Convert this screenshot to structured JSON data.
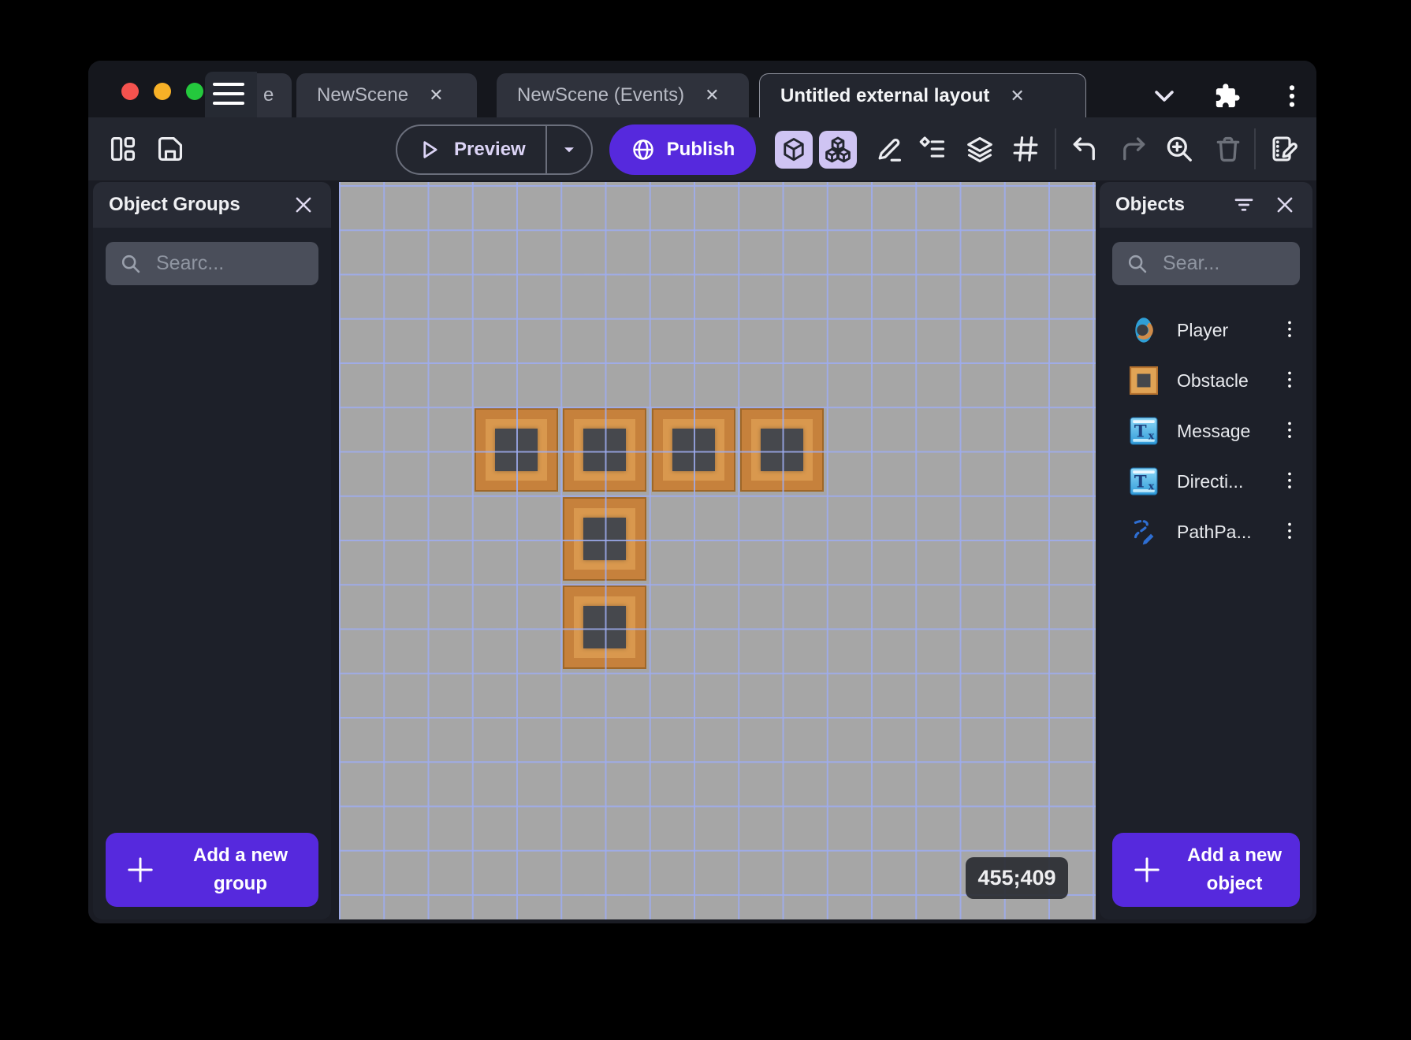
{
  "window": {
    "traffic_lights": [
      "close",
      "minimize",
      "zoom"
    ],
    "tabs": [
      {
        "label": "e",
        "partial": true
      },
      {
        "label": "NewScene",
        "active": false
      },
      {
        "label": "NewScene (Events)",
        "active": false
      },
      {
        "label": "Untitled external layout",
        "active": true
      }
    ]
  },
  "toolbar": {
    "preview_label": "Preview",
    "publish_label": "Publish"
  },
  "left_panel": {
    "title": "Object Groups",
    "search_placeholder": "Searc...",
    "add_button_label": "Add a new group"
  },
  "right_panel": {
    "title": "Objects",
    "search_placeholder": "Sear...",
    "items": [
      {
        "name": "Player",
        "icon": "player-sprite-icon"
      },
      {
        "name": "Obstacle",
        "icon": "obstacle-block-icon"
      },
      {
        "name": "Message",
        "icon": "text-object-icon"
      },
      {
        "name": "Directi...",
        "icon": "text-object-icon"
      },
      {
        "name": "PathPa...",
        "icon": "path-paint-icon"
      }
    ],
    "add_button_label": "Add a new object"
  },
  "canvas": {
    "coordinates": "455;409",
    "instances": [
      {
        "object": "Obstacle",
        "col": 3,
        "row": 5
      },
      {
        "object": "Obstacle",
        "col": 5,
        "row": 5
      },
      {
        "object": "Obstacle",
        "col": 7,
        "row": 5
      },
      {
        "object": "Obstacle",
        "col": 9,
        "row": 5
      },
      {
        "object": "Obstacle",
        "col": 5,
        "row": 7
      },
      {
        "object": "Obstacle",
        "col": 5,
        "row": 9
      }
    ]
  },
  "colors": {
    "accent_purple": "#5629dd",
    "lavender_toggle": "#cfc4f3",
    "canvas_gray": "#a6a6a6",
    "grid_line": "#9eacf0",
    "block_orange": "#c6813c",
    "block_center": "#46484d",
    "traffic_red": "#f4524e",
    "traffic_yellow": "#f7b127",
    "traffic_green": "#24c93d"
  }
}
